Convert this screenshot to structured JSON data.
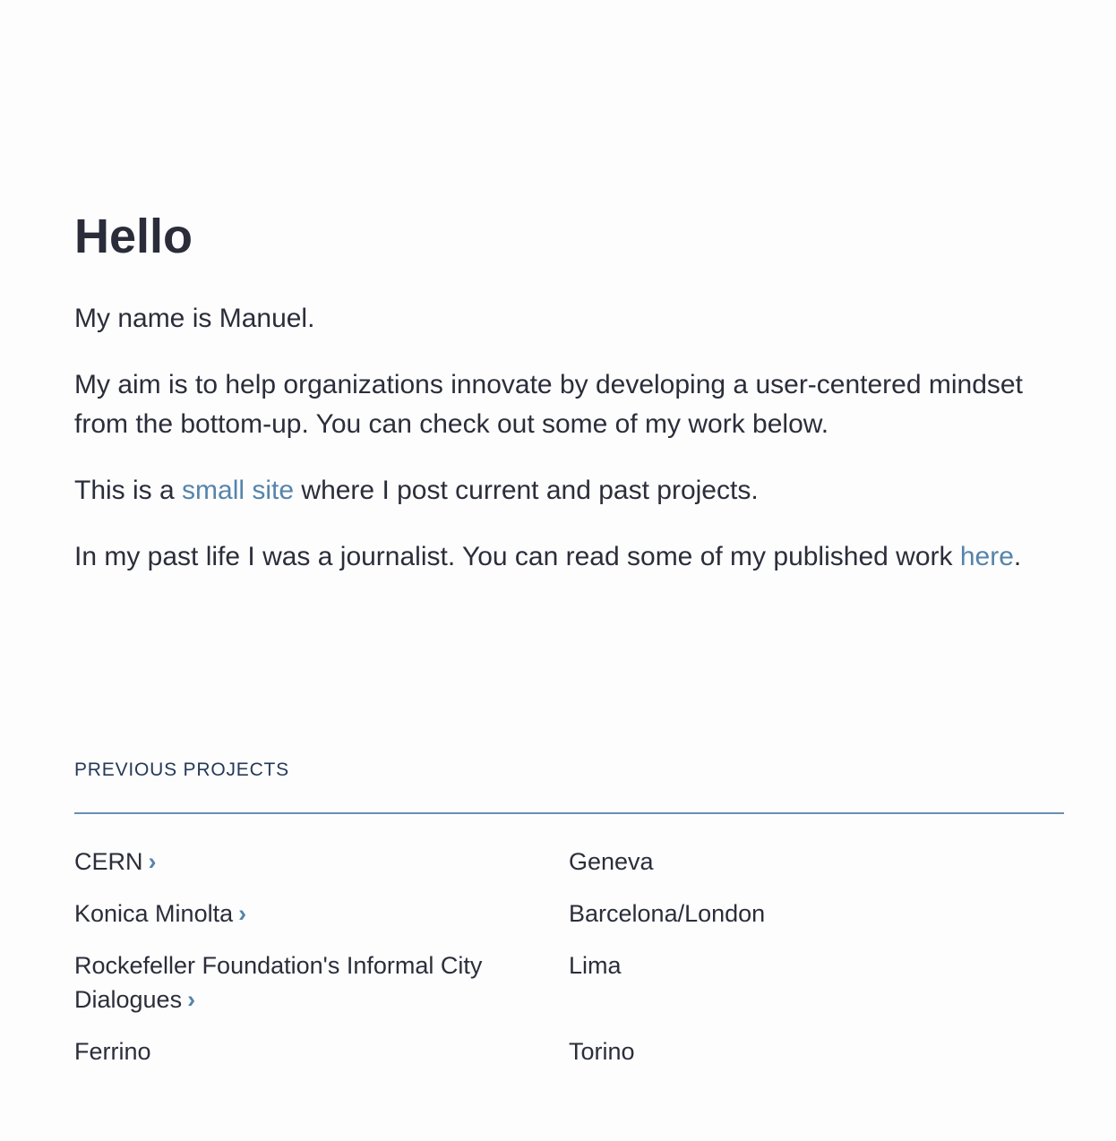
{
  "intro": {
    "title": "Hello",
    "p1": "My name is Manuel.",
    "p2": "My aim is to help organizations innovate by developing a user-centered mindset from the bottom-up. You can check out some of my work below.",
    "p3_before": "This is a ",
    "p3_link": "small site",
    "p3_after": " where I post current and past projects.",
    "p4_before": "In my past life I was a journalist. You can read some of my published work ",
    "p4_link": "here",
    "p4_after": "."
  },
  "projects": {
    "heading": "PREVIOUS PROJECTS",
    "items": [
      {
        "name": "CERN",
        "city": "Geneva",
        "arrow": "›"
      },
      {
        "name": "Konica Minolta",
        "city": "Barcelona/London",
        "arrow": "›"
      },
      {
        "name": "Rockefeller Foundation's Informal City Dialogues",
        "city": "Lima",
        "arrow": "›"
      },
      {
        "name": "Ferrino",
        "city": "Torino",
        "arrow": ""
      }
    ]
  },
  "colors": {
    "link": "#5584ab",
    "text": "#2b2e3a",
    "divider": "#6b8eb2"
  }
}
